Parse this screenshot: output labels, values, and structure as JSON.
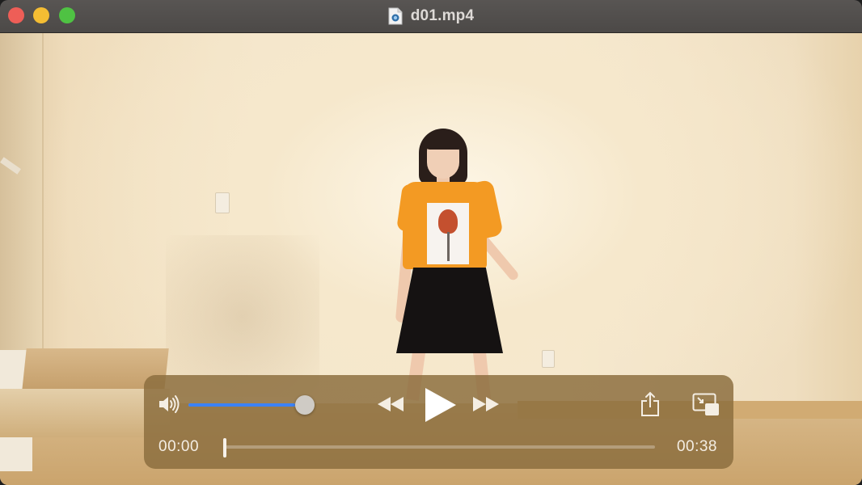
{
  "window": {
    "title": "d01.mp4",
    "file_icon": "video-file-icon",
    "buttons": [
      "close",
      "minimize",
      "zoom"
    ]
  },
  "video": {
    "description_icon": "video-frame"
  },
  "controls": {
    "volume": {
      "icon": "speaker-icon",
      "level": 0.92
    },
    "rewind_icon": "rewind-icon",
    "play_icon": "play-icon",
    "forward_icon": "fast-forward-icon",
    "share_icon": "share-icon",
    "pip_icon": "picture-in-picture-icon",
    "elapsed": "00:00",
    "remaining": "00:38",
    "progress": 0.0,
    "accent_color": "#3b82f6"
  }
}
